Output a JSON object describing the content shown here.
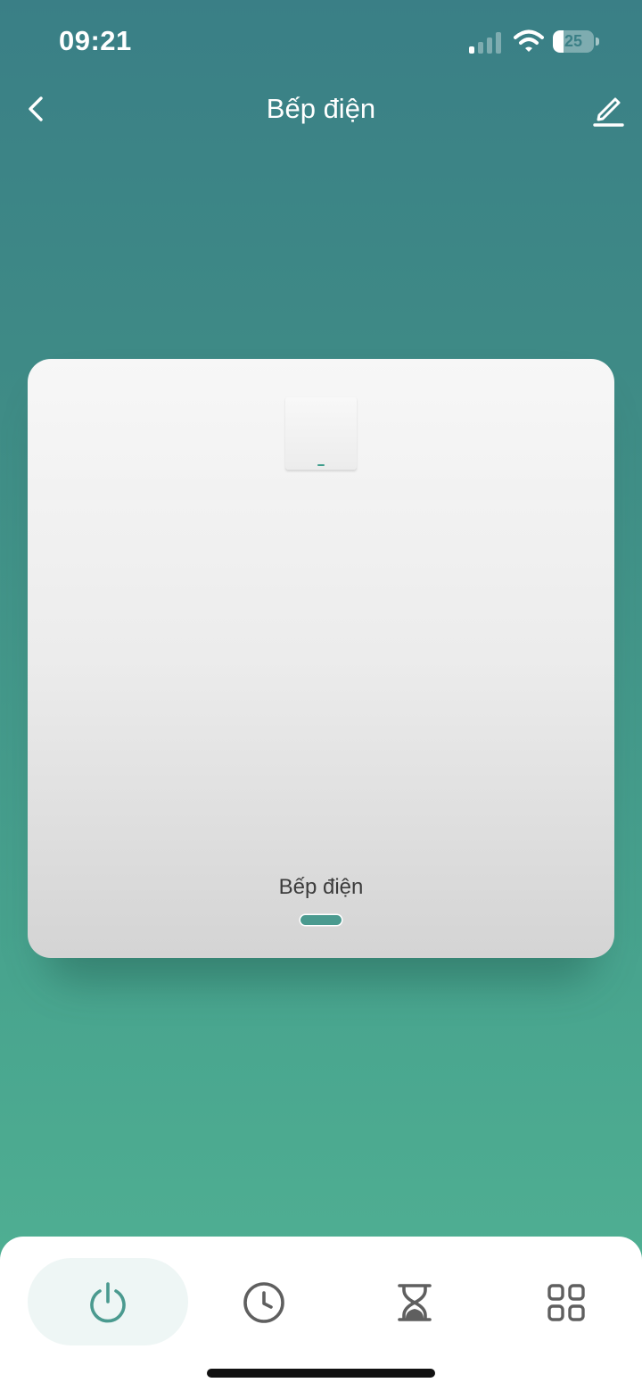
{
  "status_bar": {
    "time": "09:21",
    "battery_level": "25",
    "signal_bars_active": 1,
    "signal_bars_total": 4
  },
  "header": {
    "title": "Bếp điện",
    "back_icon": "chevron-left-icon",
    "edit_icon": "pencil-icon"
  },
  "switch": {
    "label": "Bếp điện",
    "state": "off",
    "indicator_color": "#4a9a8f"
  },
  "tabs": [
    {
      "icon": "power-icon",
      "active": true
    },
    {
      "icon": "clock-icon",
      "active": false
    },
    {
      "icon": "hourglass-icon",
      "active": false
    },
    {
      "icon": "grid-icon",
      "active": false
    }
  ],
  "colors": {
    "accent": "#4a9a8f",
    "background_top": "#3a7f86",
    "background_bottom": "#52b394",
    "inactive_icon": "#5f5f5f"
  }
}
